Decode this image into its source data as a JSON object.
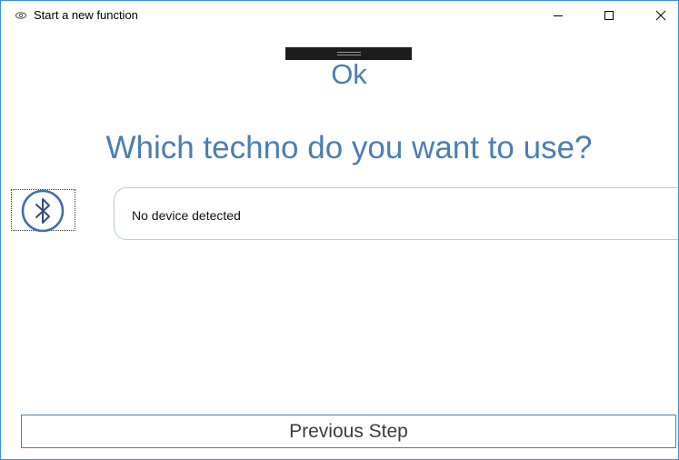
{
  "window": {
    "title": "Start a new function",
    "controls": {
      "minimize": "minimize",
      "maximize": "maximize",
      "close": "close"
    },
    "accent_border_color": "#3f8fd8"
  },
  "main": {
    "status_text": "Ok",
    "question": "Which techno do you want to use?",
    "technologies": [
      {
        "name": "bluetooth",
        "icon": "bluetooth-icon",
        "selected": true
      }
    ],
    "devices": {
      "empty_message": "No device detected"
    }
  },
  "footer": {
    "previous_label": "Previous Step"
  },
  "colors": {
    "accent_text": "#4a7eb5",
    "drag_handle": "#1c1c1c",
    "list_border": "#b9cbe0"
  }
}
